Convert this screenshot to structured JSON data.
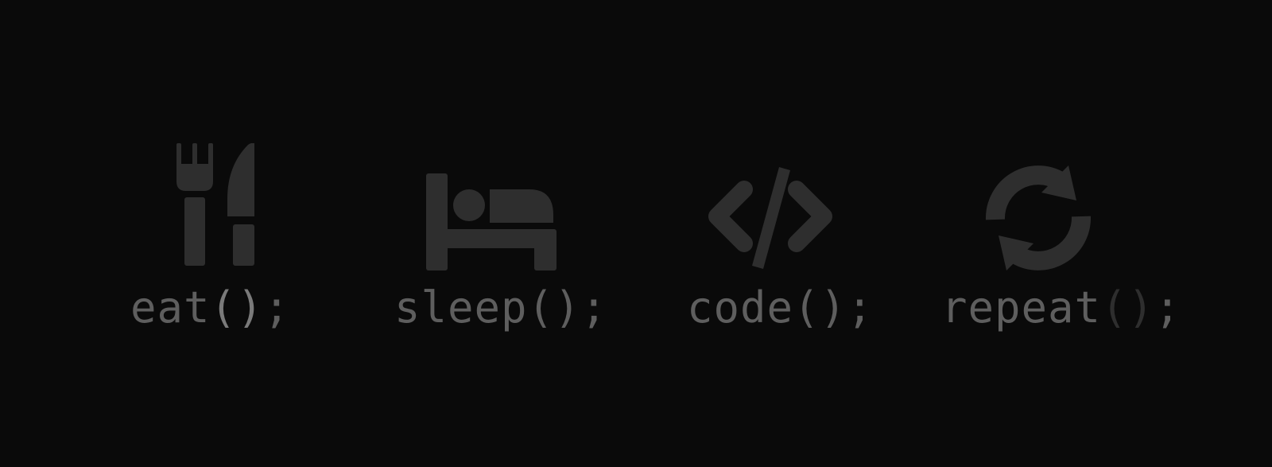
{
  "banner": {
    "background_color": "#0a0a0a",
    "icon_color": "#2e2e2e",
    "text_color": "#5e5e5e",
    "items": [
      {
        "icon": "fork-knife-icon",
        "name": "eat",
        "parens": "()",
        "semicolon": ";",
        "parens_color": "#7a7a7a"
      },
      {
        "icon": "bed-icon",
        "name": "sleep",
        "parens": "()",
        "semicolon": ";",
        "parens_color": "#5e5e5e"
      },
      {
        "icon": "code-icon",
        "name": "code",
        "parens": "()",
        "semicolon": ";",
        "parens_color": "#5e5e5e"
      },
      {
        "icon": "refresh-icon",
        "name": "repeat",
        "parens": "()",
        "semicolon": ";",
        "parens_color": "#2e2e2e"
      }
    ]
  }
}
